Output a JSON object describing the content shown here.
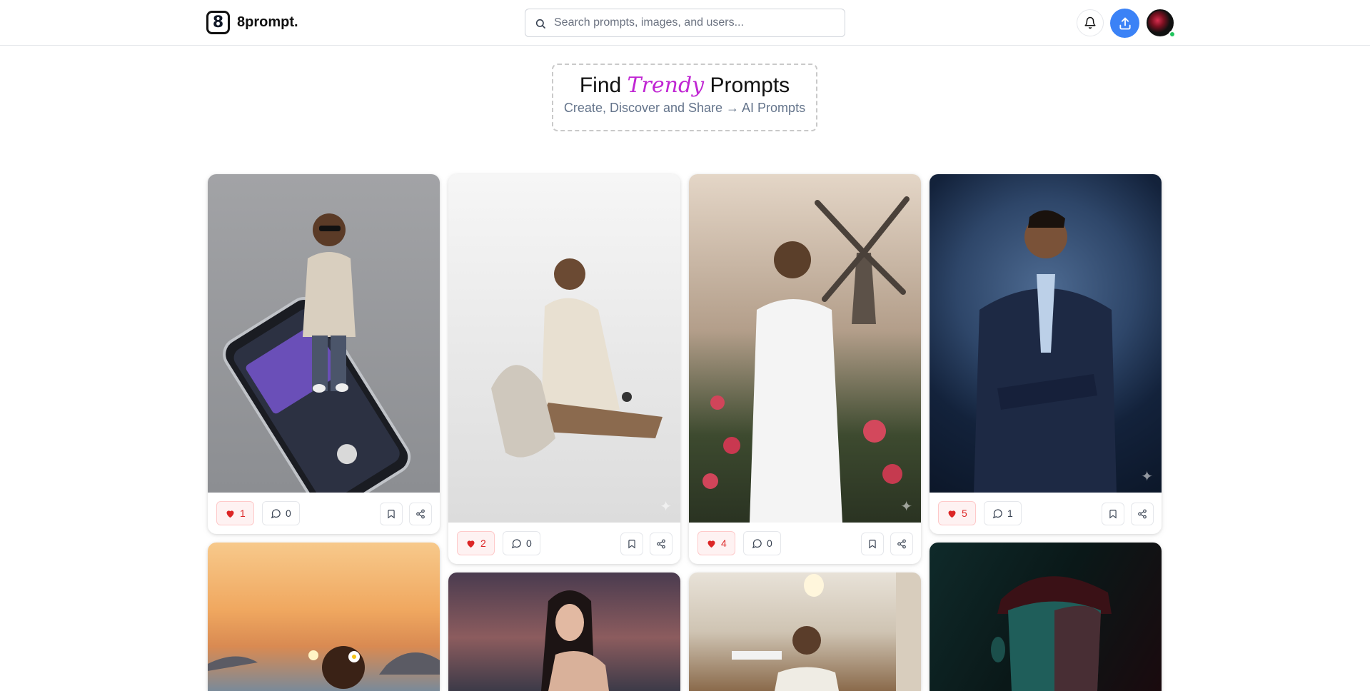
{
  "header": {
    "logo_mark": "8",
    "logo_text": "8prompt.",
    "search_placeholder": "Search prompts, images, and users..."
  },
  "hero": {
    "title_before": "Find",
    "title_accent": "Trendy",
    "title_after": "Prompts",
    "subtitle": "Create, Discover and Share → AI Prompts"
  },
  "colors": {
    "accent": "#c026d3",
    "upload": "#3b82f6",
    "like": "#dc2626",
    "online": "#22c55e"
  },
  "cards": [
    {
      "likes": "1",
      "comments": "0"
    },
    {
      "likes": "2",
      "comments": "0"
    },
    {
      "likes": "4",
      "comments": "0"
    },
    {
      "likes": "5",
      "comments": "1"
    }
  ],
  "icons": [
    "search-icon",
    "bell-icon",
    "upload-icon",
    "heart-icon",
    "comment-icon",
    "bookmark-icon",
    "share-icon",
    "sparkle-icon"
  ]
}
